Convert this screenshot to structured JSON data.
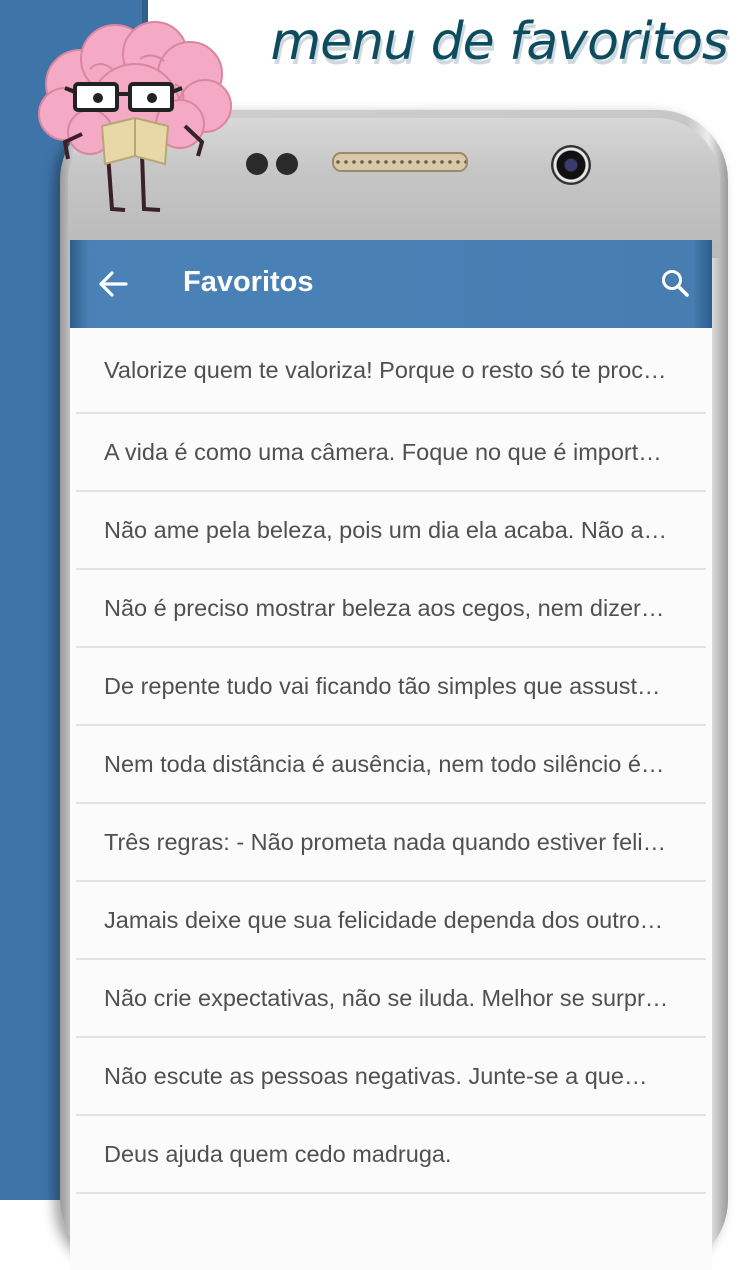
{
  "promo": {
    "title": "menu de favoritos"
  },
  "appbar": {
    "title": "Favoritos",
    "back_icon": "arrow-back-icon",
    "search_icon": "search-icon"
  },
  "colors": {
    "accent": "#477db1",
    "band": "#3f74a8",
    "title": "#0d4c5e"
  },
  "favorites": [
    "Valorize quem te valoriza! Porque o resto só te proc…",
    "A vida é como uma câmera. Foque no que é import…",
    "Não ame pela beleza, pois um dia ela acaba. Não a…",
    "Não é preciso mostrar beleza aos cegos, nem dizer…",
    "De repente tudo vai ficando tão simples que assust…",
    "Nem toda distância é ausência, nem todo silêncio é…",
    "Três regras: - Não prometa nada quando estiver feli…",
    "Jamais deixe que sua felicidade dependa dos outro…",
    "Não crie expectativas, não se iluda. Melhor se surpr…",
    "Não escute as pessoas negativas. Junte-se a que…",
    "Deus ajuda quem cedo madruga."
  ]
}
